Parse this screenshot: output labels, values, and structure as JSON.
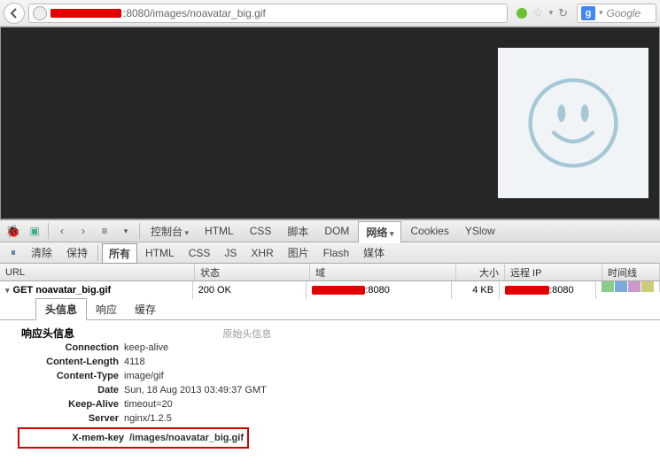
{
  "browser": {
    "url_visible": ":8080/images/noavatar_big.gif",
    "search_engine": "Google",
    "search_icon_letter": "g"
  },
  "firebug": {
    "main_tabs": [
      "控制台",
      "HTML",
      "CSS",
      "脚本",
      "DOM",
      "网络",
      "Cookies",
      "YSlow"
    ],
    "main_active": "网络",
    "sub_left": [
      "清除",
      "保持"
    ],
    "sub_tabs": [
      "所有",
      "HTML",
      "CSS",
      "JS",
      "XHR",
      "图片",
      "Flash",
      "媒体"
    ],
    "sub_active": "所有"
  },
  "net_table": {
    "columns": {
      "url": "URL",
      "status": "状态",
      "domain": "域",
      "size": "大小",
      "remote_ip": "远程 IP",
      "timeline": "时间线"
    },
    "row": {
      "method": "GET",
      "file": "noavatar_big.gif",
      "status": "200 OK",
      "domain_suffix": ":8080",
      "size": "4 KB",
      "ip_suffix": ":8080"
    }
  },
  "request_tabs": {
    "items": [
      "头信息",
      "响应",
      "缓存"
    ],
    "active": "头信息"
  },
  "headers": {
    "section_title": "响应头信息",
    "raw_label": "原始头信息",
    "rows": [
      {
        "name": "Connection",
        "value": "keep-alive"
      },
      {
        "name": "Content-Length",
        "value": "4118"
      },
      {
        "name": "Content-Type",
        "value": "image/gif"
      },
      {
        "name": "Date",
        "value": "Sun, 18 Aug 2013 03:49:37 GMT"
      },
      {
        "name": "Keep-Alive",
        "value": "timeout=20"
      },
      {
        "name": "Server",
        "value": "nginx/1.2.5"
      }
    ],
    "highlighted": {
      "name": "X-mem-key",
      "value": "/images/noavatar_big.gif"
    }
  }
}
